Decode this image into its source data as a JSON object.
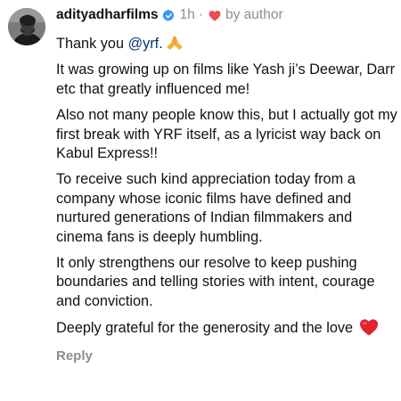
{
  "comment": {
    "username": "adityadharfilms",
    "time": "1h",
    "separator": "·",
    "liked_by_label": "by author",
    "icons": {
      "avatar": "profile-photo",
      "verified": "verified-badge-icon",
      "author_like": "red-heart-icon",
      "emoji_1": "folded-hands-emoji",
      "emoji_2": "red-heart-emoji"
    },
    "colors": {
      "verified": "#3897f0",
      "heart": "#ed4956",
      "mention": "#00376b",
      "meta": "#8e8e8e"
    },
    "paragraphs": {
      "p1_prefix": "Thank you ",
      "p1_mention": "@yrf",
      "p1_suffix": ".",
      "p2": "It was growing up on films like Yash ji’s Deewar, Darr etc that greatly influenced me!",
      "p3": "Also not many people know this, but I actually got my first break with YRF itself, as a lyricist way back on Kabul Express!!",
      "p4": "To receive such kind appreciation today from a company whose iconic films have defined and nurtured generations of Indian filmmakers and cinema fans is deeply humbling.",
      "p5": "It only strengthens our resolve to keep pushing boundaries and telling stories with intent, courage and conviction.",
      "p6": "Deeply grateful for the generosity and the love "
    },
    "reply_label": "Reply"
  }
}
